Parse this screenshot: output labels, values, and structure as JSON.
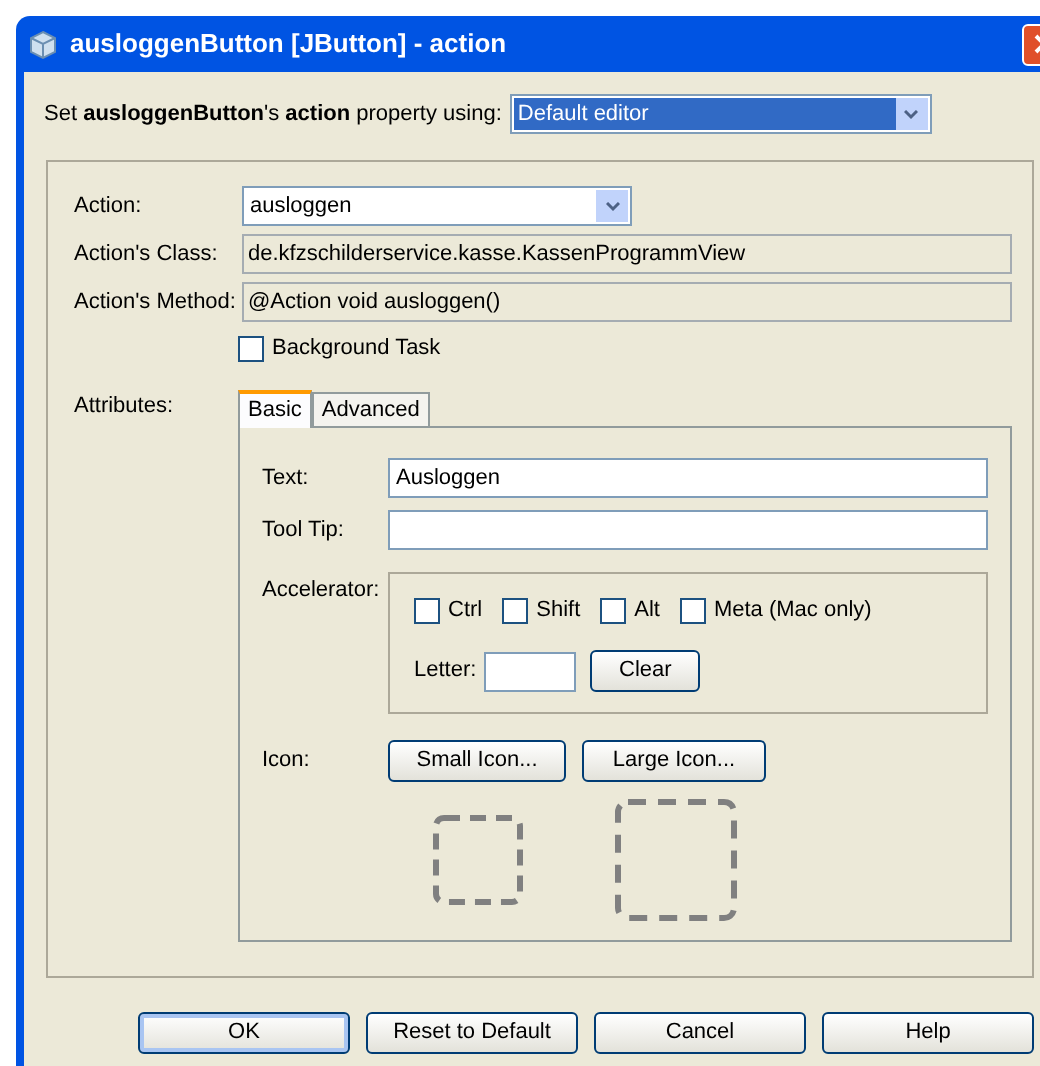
{
  "window": {
    "title": "ausloggenButton [JButton] - action"
  },
  "source": {
    "label": "Set **ausloggenButton**'s **action** property using:",
    "value": "Default editor"
  },
  "fields": [
    {
      "kind": "combo",
      "label": "Action:",
      "value": "ausloggen"
    },
    {
      "kind": "readonly",
      "label": "Action's Class:",
      "value": "de.kfzschilderservice.kasse.KassenProgrammView"
    },
    {
      "kind": "readonly",
      "label": "Action's Method:",
      "value": "@Action void ausloggen()"
    }
  ],
  "background_task": {
    "label": "Background Task",
    "checked": false
  },
  "attributes": {
    "label": "Attributes:",
    "tabs": [
      {
        "label": "Basic",
        "selected": true
      },
      {
        "label": "Advanced",
        "selected": false
      }
    ],
    "text": {
      "label": "Text:",
      "value": "Ausloggen"
    },
    "tool_tip": {
      "label": "Tool Tip:"
    },
    "accelerator": {
      "label": "Accelerator:",
      "modifiers": [
        {
          "label": "Ctrl",
          "checked": false
        },
        {
          "label": "Shift",
          "checked": false
        },
        {
          "label": "Alt",
          "checked": false
        },
        {
          "label": "Meta (Mac only)",
          "checked": false
        }
      ],
      "letter_label": "Letter:",
      "clear": "Clear"
    },
    "icon": {
      "label": "Icon:",
      "buttons": [
        "Small Icon...",
        "Large Icon..."
      ]
    }
  },
  "buttons": [
    {
      "label": "OK",
      "default": true
    },
    {
      "label": "Reset to Default",
      "default": false
    },
    {
      "label": "Cancel",
      "default": false
    },
    {
      "label": "Help",
      "default": false
    }
  ]
}
